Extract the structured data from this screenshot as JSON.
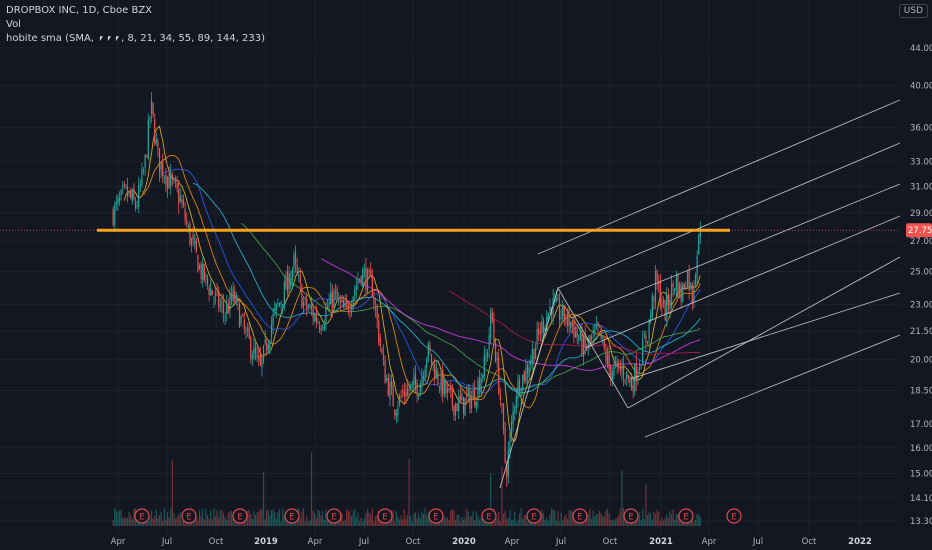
{
  "legend": {
    "title": "DROPBOX INC, 1D, Cboe BZX",
    "vol": "Vol",
    "indicator": "hobite sma (SMA, ⎖⎖⎖, 8, 21, 34, 55, 89, 144, 233)"
  },
  "currency_label": "USD",
  "last_price_label": "27.75",
  "colors": {
    "background": "#131722",
    "up": "#26a69a",
    "down": "#ef5350",
    "resistance": "#f7a21b",
    "pitchfork": "#d1d4dc",
    "last_price_tag": "#ef5350",
    "earnings": "#e0484f"
  },
  "chart_data": {
    "type": "candlestick",
    "title": "DROPBOX INC, 1D, Cboe BZX",
    "y_scale": "log",
    "y_ticks": [
      "44.00",
      "40.00",
      "36.00",
      "33.00",
      "31.00",
      "29.00",
      "27.00",
      "25.00",
      "23.00",
      "21.50",
      "20.00",
      "18.50",
      "17.00",
      "16.00",
      "15.00",
      "14.10",
      "13.30"
    ],
    "x_ticks": [
      {
        "label": "Apr",
        "bold": false
      },
      {
        "label": "Jul",
        "bold": false
      },
      {
        "label": "Oct",
        "bold": false
      },
      {
        "label": "2019",
        "bold": true
      },
      {
        "label": "Apr",
        "bold": false
      },
      {
        "label": "Jul",
        "bold": false
      },
      {
        "label": "Oct",
        "bold": false
      },
      {
        "label": "2020",
        "bold": true
      },
      {
        "label": "Apr",
        "bold": false
      },
      {
        "label": "Jul",
        "bold": false
      },
      {
        "label": "Oct",
        "bold": false
      },
      {
        "label": "2021",
        "bold": true
      },
      {
        "label": "Apr",
        "bold": false
      },
      {
        "label": "Jul",
        "bold": false
      },
      {
        "label": "Oct",
        "bold": false
      },
      {
        "label": "2022",
        "bold": true
      }
    ],
    "last_price": 27.75,
    "resistance_level": 27.75,
    "earnings_marker": "E",
    "earnings_count": 13,
    "price_path": [
      {
        "date": "2018-03-23",
        "price": 29.0
      },
      {
        "date": "2018-04-15",
        "price": 30.5
      },
      {
        "date": "2018-05-05",
        "price": 29.5
      },
      {
        "date": "2018-05-20",
        "price": 32.5
      },
      {
        "date": "2018-06-01",
        "price": 38.0
      },
      {
        "date": "2018-06-15",
        "price": 33.0
      },
      {
        "date": "2018-07-05",
        "price": 31.5
      },
      {
        "date": "2018-07-25",
        "price": 30.0
      },
      {
        "date": "2018-08-10",
        "price": 27.5
      },
      {
        "date": "2018-09-01",
        "price": 25.0
      },
      {
        "date": "2018-09-25",
        "price": 23.5
      },
      {
        "date": "2018-10-15",
        "price": 22.5
      },
      {
        "date": "2018-11-01",
        "price": 23.5
      },
      {
        "date": "2018-11-20",
        "price": 21.5
      },
      {
        "date": "2018-12-20",
        "price": 19.5
      },
      {
        "date": "2019-01-10",
        "price": 22.0
      },
      {
        "date": "2019-02-05",
        "price": 24.0
      },
      {
        "date": "2019-02-20",
        "price": 25.5
      },
      {
        "date": "2019-03-10",
        "price": 23.0
      },
      {
        "date": "2019-04-10",
        "price": 22.0
      },
      {
        "date": "2019-05-05",
        "price": 23.5
      },
      {
        "date": "2019-05-25",
        "price": 22.5
      },
      {
        "date": "2019-06-25",
        "price": 25.0
      },
      {
        "date": "2019-07-15",
        "price": 24.0
      },
      {
        "date": "2019-08-05",
        "price": 19.5
      },
      {
        "date": "2019-08-25",
        "price": 17.8
      },
      {
        "date": "2019-09-15",
        "price": 18.5
      },
      {
        "date": "2019-10-10",
        "price": 18.8
      },
      {
        "date": "2019-10-25",
        "price": 20.5
      },
      {
        "date": "2019-11-15",
        "price": 19.0
      },
      {
        "date": "2019-12-10",
        "price": 17.9
      },
      {
        "date": "2019-12-30",
        "price": 17.9
      },
      {
        "date": "2020-01-20",
        "price": 18.3
      },
      {
        "date": "2020-02-10",
        "price": 20.0
      },
      {
        "date": "2020-02-20",
        "price": 22.5
      },
      {
        "date": "2020-03-10",
        "price": 17.5
      },
      {
        "date": "2020-03-18",
        "price": 15.0
      },
      {
        "date": "2020-04-05",
        "price": 18.5
      },
      {
        "date": "2020-04-25",
        "price": 19.5
      },
      {
        "date": "2020-05-20",
        "price": 21.5
      },
      {
        "date": "2020-06-10",
        "price": 23.0
      },
      {
        "date": "2020-06-25",
        "price": 22.5
      },
      {
        "date": "2020-07-15",
        "price": 22.0
      },
      {
        "date": "2020-08-10",
        "price": 20.5
      },
      {
        "date": "2020-09-05",
        "price": 21.5
      },
      {
        "date": "2020-09-25",
        "price": 19.5
      },
      {
        "date": "2020-10-20",
        "price": 19.5
      },
      {
        "date": "2020-11-05",
        "price": 18.8
      },
      {
        "date": "2020-11-20",
        "price": 20.0
      },
      {
        "date": "2020-12-05",
        "price": 21.5
      },
      {
        "date": "2020-12-20",
        "price": 24.5
      },
      {
        "date": "2021-01-05",
        "price": 22.5
      },
      {
        "date": "2021-01-25",
        "price": 24.5
      },
      {
        "date": "2021-02-05",
        "price": 23.5
      },
      {
        "date": "2021-02-15",
        "price": 25.0
      },
      {
        "date": "2021-02-25",
        "price": 23.5
      },
      {
        "date": "2021-03-05",
        "price": 26.0
      },
      {
        "date": "2021-03-12",
        "price": 27.75
      }
    ],
    "moving_averages": [
      "SMA 8",
      "SMA 21",
      "SMA 34",
      "SMA 55",
      "SMA 89",
      "SMA 144",
      "SMA 233"
    ]
  }
}
